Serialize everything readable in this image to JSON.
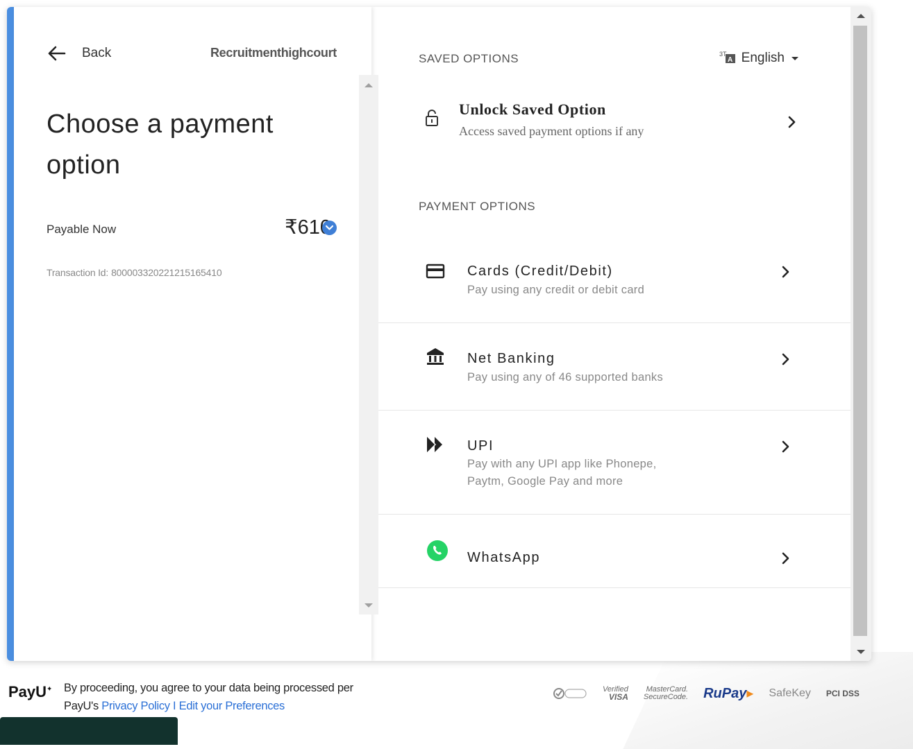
{
  "header": {
    "back_label": "Back",
    "merchant_name": "Recruitmenthighcourt"
  },
  "summary": {
    "title": "Choose a payment option",
    "payable_label": "Payable Now",
    "amount": "₹610",
    "transaction_label": "Transaction Id:",
    "transaction_id": "8000033202212151654​10"
  },
  "saved": {
    "section_label": "SAVED OPTIONS",
    "language": "English",
    "unlock_title": "Unlock Saved Option",
    "unlock_subtitle": "Access saved payment options if any"
  },
  "payment": {
    "section_label": "PAYMENT OPTIONS",
    "options": [
      {
        "icon": "credit-card-icon",
        "title": "Cards (Credit/Debit)",
        "subtitle": "Pay using any credit or debit card"
      },
      {
        "icon": "bank-icon",
        "title": "Net Banking",
        "subtitle": "Pay using any of 46 supported banks"
      },
      {
        "icon": "upi-icon",
        "title": "UPI",
        "subtitle": "Pay with any UPI app like Phonepe, Paytm, Google Pay and more"
      },
      {
        "icon": "whatsapp-icon",
        "title": "WhatsApp",
        "subtitle": ""
      }
    ]
  },
  "footer": {
    "brand": "PayU",
    "consent_text": "By proceeding, you agree to your data being processed per",
    "consent_prefix": "PayU's",
    "privacy_link": "Privacy Policy",
    "separator": "I",
    "preferences_link": "Edit your Preferences",
    "badges": {
      "verified_visa_top": "Verified",
      "verified_visa_bottom": "VISA",
      "mastercard_top": "MasterCard.",
      "mastercard_bottom": "SecureCode.",
      "rupay": "RuPay",
      "safekey": "SafeKey",
      "pci": "PCI DSS"
    }
  },
  "colors": {
    "accent": "#4a8ee0",
    "link": "#2a6fd6",
    "whatsapp": "#25d366"
  }
}
